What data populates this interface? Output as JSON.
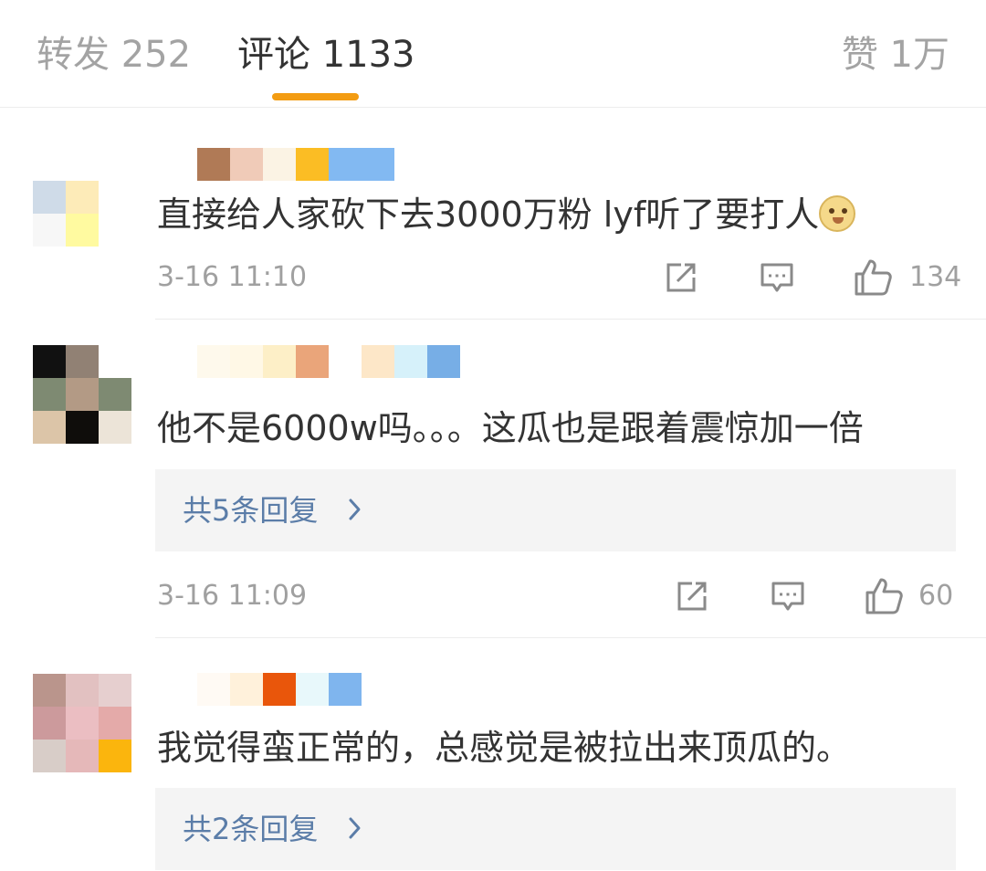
{
  "tabs": {
    "repost": "转发 252",
    "comments": "评论 1133",
    "likes": "赞 1万",
    "accent_color": "#f39c12"
  },
  "comments": [
    {
      "text": "直接给人家砍下去3000万粉 lyf听了要打人",
      "emoji": "doge-emoji",
      "time": "3-16 11:10",
      "likes": "134",
      "reply_label": ""
    },
    {
      "text": "他不是6000w吗。。。这瓜也是跟着震惊加一倍",
      "time": "3-16 11:09",
      "likes": "60",
      "reply_label": "共5条回复"
    },
    {
      "text": "我觉得蛮正常的，总感觉是被拉出来顶瓜的。",
      "time": "",
      "likes": "",
      "reply_label": "共2条回复"
    }
  ],
  "icons": {
    "repost": "share-icon",
    "comment": "comment-icon",
    "like": "thumbs-up-icon",
    "chevron": "chevron-right-icon"
  },
  "colors": {
    "link": "#5b7da8",
    "meta": "#a0a0a0",
    "reply_bg": "#f4f4f4"
  }
}
